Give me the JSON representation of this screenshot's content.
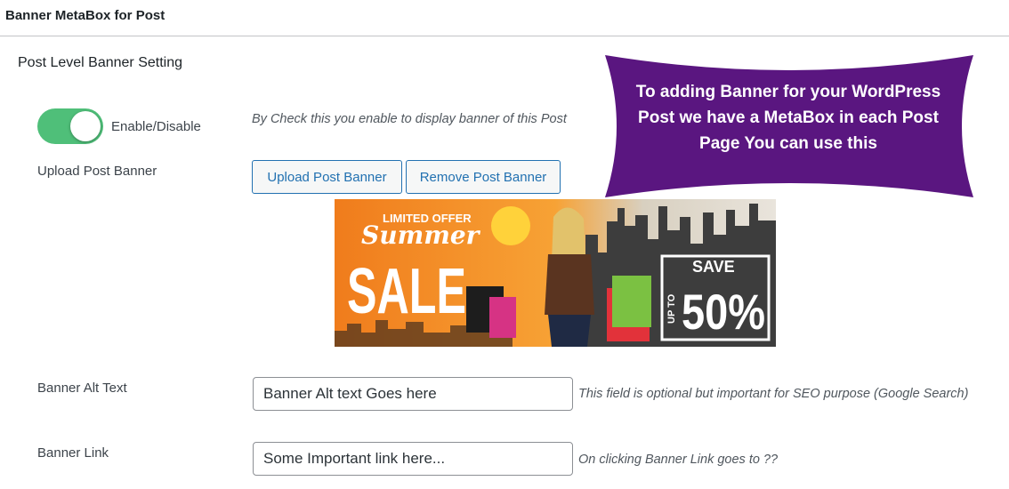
{
  "metabox": {
    "title": "Banner MetaBox for Post"
  },
  "section": {
    "title": "Post Level Banner Setting"
  },
  "toggle": {
    "label": "Enable/Disable",
    "state": "on",
    "color": "#4fbf79",
    "help": "By Check this you enable to display banner of this Post"
  },
  "upload": {
    "label": "Upload Post Banner",
    "upload_button": "Upload Post Banner",
    "remove_button": "Remove Post Banner"
  },
  "callout": {
    "text": "To adding Banner for your WordPress Post we have a MetaBox in each Post Page You can use this",
    "color": "#5a1680"
  },
  "banner": {
    "line1": "LIMITED OFFER",
    "line2": "Summer",
    "line3": "SALE",
    "badge_top": "SAVE",
    "badge_side": "UP TO",
    "badge_value": "50%"
  },
  "alt_text": {
    "label": "Banner Alt Text",
    "value": "Banner Alt text Goes here",
    "help": "This field is optional but important for SEO purpose (Google Search)"
  },
  "link": {
    "label": "Banner Link",
    "value": "Some Important link here...",
    "help": "On clicking Banner Link goes to ??"
  }
}
